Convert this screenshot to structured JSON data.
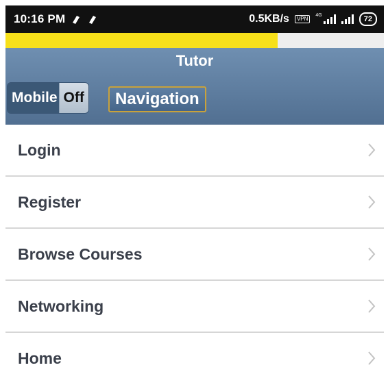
{
  "status_bar": {
    "time": "10:16 PM",
    "left_icons": [
      "notification-icon",
      "notification-icon"
    ],
    "speed": "0.5KB/s",
    "vpn": "VPN",
    "network_tag": "4G",
    "battery": "72"
  },
  "progress": {
    "fraction": 0.72,
    "fill_color": "#f7e01a"
  },
  "header": {
    "title": "Tutor",
    "toggle": {
      "on_label": "Mobile",
      "off_label": "Off"
    },
    "nav_label": "Navigation"
  },
  "menu": {
    "items": [
      {
        "label": "Login",
        "icon": "chevron-right-icon"
      },
      {
        "label": "Register",
        "icon": "chevron-right-icon"
      },
      {
        "label": "Browse Courses",
        "icon": "chevron-right-icon"
      },
      {
        "label": "Networking",
        "icon": "chevron-right-icon"
      },
      {
        "label": "Home",
        "icon": "chevron-right-icon"
      }
    ]
  }
}
